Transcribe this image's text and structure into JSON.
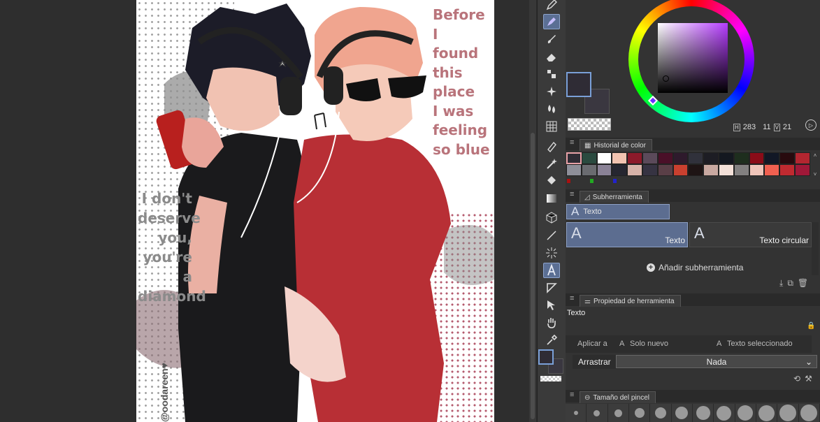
{
  "canvas": {
    "caption_right": "Before I\nfound\nthis place\nI was\nfeeling\nso blue",
    "caption_left": "I don't\ndeserve\nyou,\nyou're a\ndiamond",
    "signature": "@oodareen♥"
  },
  "color_panel": {
    "h": "283",
    "s": "11",
    "v": "21",
    "main_color": "#2f2c35",
    "sub_color": "#3a3740"
  },
  "history": {
    "title": "Historial de color",
    "row1": [
      "#2f2c35",
      "#2a4a3f",
      "#ffffff",
      "#f2c3b0",
      "#8c1a2a",
      "#5b4a5a",
      "#4a1028",
      "#2e1a2c",
      "#30313b",
      "#1d1d24",
      "#141820",
      "#1e2e1e",
      "#8b0c18",
      "#121826",
      "#280a0e",
      "#b32630"
    ],
    "row2": [
      "#8e8f99",
      "#6a6b70",
      "#8a8296",
      "#262630",
      "#d7b3a9",
      "#363342",
      "#5a3f47",
      "#c9402f",
      "#1e1414",
      "#c8a8a0",
      "#f3e0d8",
      "#828080",
      "#eec4b9",
      "#f06050",
      "#c02a30",
      "#a01838"
    ],
    "tiny": [
      "#aa1111",
      "#22aa22",
      "#2222cc"
    ]
  },
  "subtool": {
    "title": "Subherramienta",
    "group": "Texto",
    "items": [
      "Texto",
      "Texto circular"
    ],
    "add_label": "Añadir subherramienta"
  },
  "tool_property": {
    "title": "Propiedad de herramienta",
    "tool_name": "Texto",
    "apply_label": "Aplicar a",
    "apply_new": "Solo nuevo",
    "apply_selected": "Texto seleccionado",
    "drag_label": "Arrastrar",
    "drag_value": "Nada"
  },
  "brush_size": {
    "title": "Tamaño del pincel"
  },
  "accent": "#5c6d90"
}
